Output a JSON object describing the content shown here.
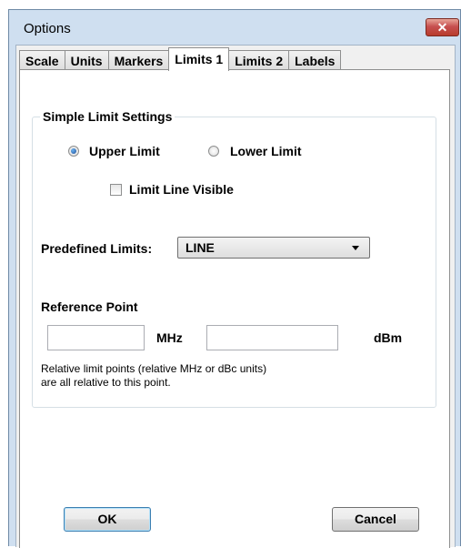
{
  "window": {
    "title": "Options",
    "close_glyph": "✕"
  },
  "tabs": [
    {
      "label": "Scale",
      "active": false
    },
    {
      "label": "Units",
      "active": false
    },
    {
      "label": "Markers",
      "active": false
    },
    {
      "label": "Limits 1",
      "active": true
    },
    {
      "label": "Limits 2",
      "active": false
    },
    {
      "label": "Labels",
      "active": false
    }
  ],
  "simple_limit": {
    "group_title": "Simple Limit Settings",
    "upper_label": "Upper Limit",
    "lower_label": "Lower Limit",
    "selected": "Upper Limit",
    "visible_label": "Limit Line Visible",
    "visible_checked": false
  },
  "predefined": {
    "label": "Predefined Limits:",
    "value": "LINE"
  },
  "reference": {
    "title": "Reference Point",
    "freq_value": "",
    "freq_unit": "MHz",
    "level_value": "",
    "level_unit": "dBm",
    "note_line1": "Relative limit points (relative MHz or dBc units)",
    "note_line2": "are all relative to this point."
  },
  "buttons": {
    "ok": "OK",
    "cancel": "Cancel"
  }
}
